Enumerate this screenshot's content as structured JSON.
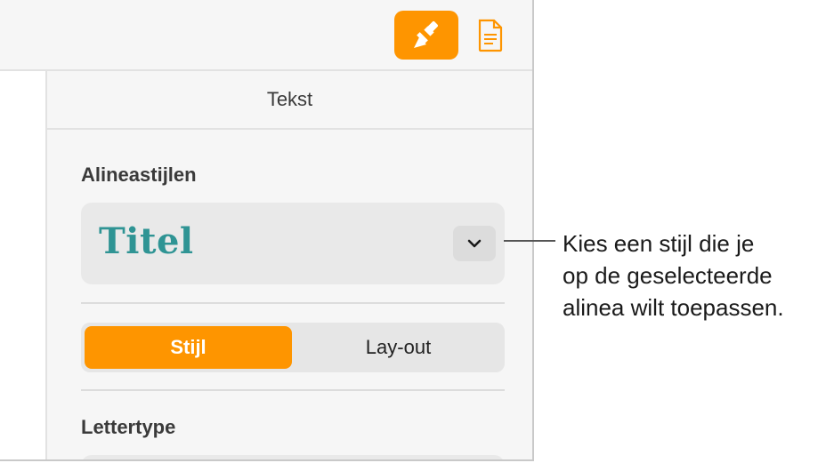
{
  "toolbar": {
    "format_icon": "paintbrush-icon",
    "document_icon": "document-icon",
    "accent_color": "#fe9500"
  },
  "sidebar": {
    "tab_label": "Tekst",
    "paragraph_styles": {
      "heading": "Alineastijlen",
      "selected_style": "Titel",
      "selected_style_color": "#2f9494"
    },
    "segments": {
      "active": "Stijl",
      "inactive": "Lay-out"
    },
    "font": {
      "heading": "Lettertype"
    }
  },
  "callout": {
    "lines": [
      "Kies een stijl die je",
      "op de geselecteerde",
      "alinea wilt toepassen."
    ]
  }
}
